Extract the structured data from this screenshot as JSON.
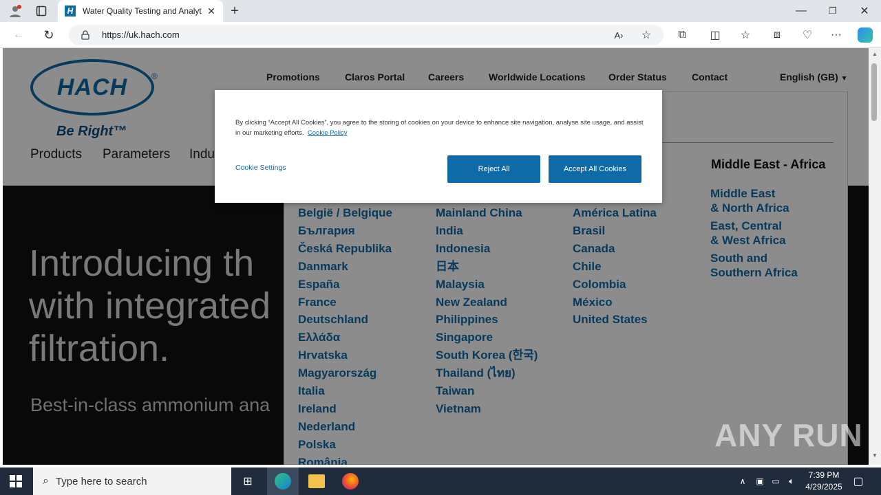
{
  "browser": {
    "tab_title": "Water Quality Testing and Analyt",
    "url": "https://uk.hach.com"
  },
  "site": {
    "brand": "HACH",
    "tagline": "Be Right™",
    "topnav": [
      "Promotions",
      "Claros Portal",
      "Careers",
      "Worldwide Locations",
      "Order Status",
      "Contact"
    ],
    "language": "English (GB)",
    "mainnav": [
      "Products",
      "Parameters",
      "Indu"
    ],
    "hero": {
      "headline_1": "Introducing th",
      "headline_2": "with integrated",
      "headline_3": "filtration.",
      "subline": "Best-in-class ammonium ana"
    }
  },
  "locations": {
    "europe": [
      "België / Belgique",
      "България",
      "Česká Republika",
      "Danmark",
      "España",
      "France",
      "Deutschland",
      "Ελλάδα",
      "Hrvatska",
      "Magyarország",
      "Italia",
      "Ireland",
      "Nederland",
      "Polska",
      "România"
    ],
    "asia": [
      "Mainland China",
      "India",
      "Indonesia",
      "日本",
      "Malaysia",
      "New Zealand",
      "Philippines",
      "Singapore",
      "South Korea (한국)",
      "Thailand (ไทย)",
      "Taiwan",
      "Vietnam"
    ],
    "americas": [
      "América Latina",
      "Brasil",
      "Canada",
      "Chile",
      "Colombia",
      "México",
      "United States"
    ],
    "mea_title": "Middle East - Africa",
    "mea": [
      "Middle East\n& North Africa",
      "East, Central\n& West Africa",
      "South and\nSouthern Africa"
    ]
  },
  "cookie": {
    "text": "By clicking “Accept All Cookies”, you agree to the storing of cookies on your device to enhance site navigation, analyse site usage, and assist in our marketing efforts.",
    "policy_link": "Cookie Policy",
    "settings": "Cookie Settings",
    "reject": "Reject All",
    "accept": "Accept All Cookies"
  },
  "taskbar": {
    "search_placeholder": "Type here to search",
    "time": "7:39 PM",
    "date": "4/29/2025"
  },
  "watermark": "ANY RUN"
}
